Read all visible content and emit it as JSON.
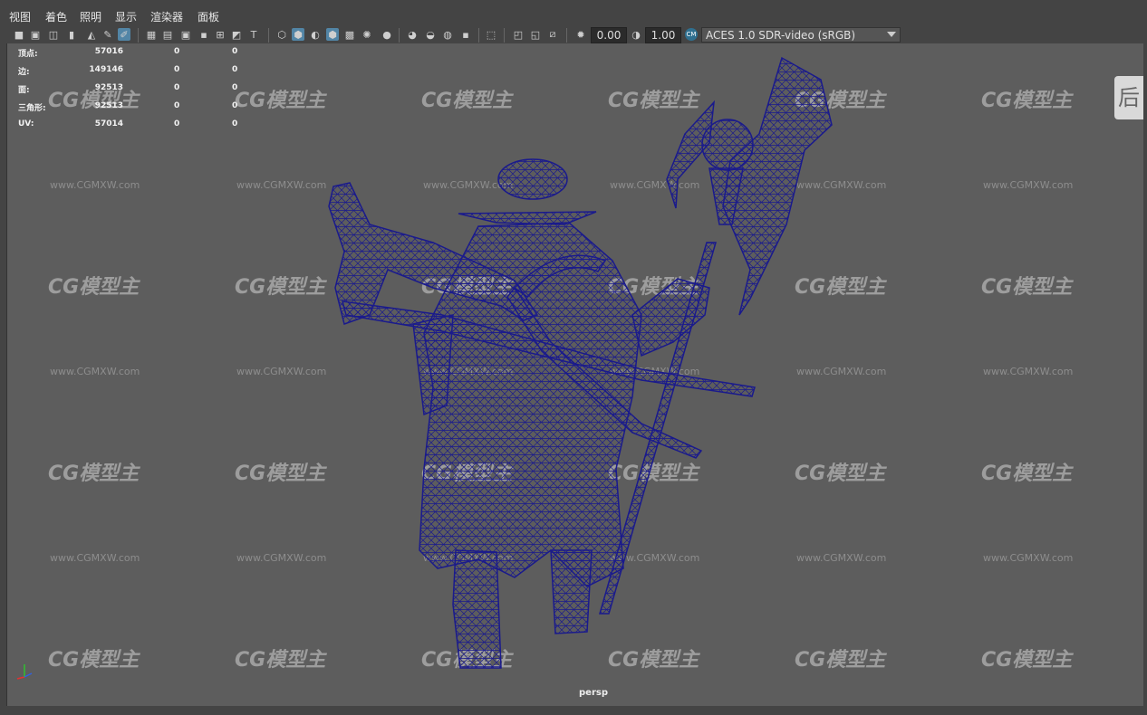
{
  "menu": {
    "items": [
      "视图",
      "着色",
      "照明",
      "显示",
      "渲染器",
      "面板"
    ]
  },
  "toolbar": {
    "value_a": "0.00",
    "value_b": "1.00",
    "color_space": "ACES 1.0 SDR-video (sRGB)"
  },
  "hud": {
    "rows": [
      {
        "label": "顶点:",
        "v1": "57016",
        "v2": "0",
        "v3": "0"
      },
      {
        "label": "边:",
        "v1": "149146",
        "v2": "0",
        "v3": "0"
      },
      {
        "label": "面:",
        "v1": "92513",
        "v2": "0",
        "v3": "0"
      },
      {
        "label": "三角形:",
        "v1": "92513",
        "v2": "0",
        "v3": "0"
      },
      {
        "label": "UV:",
        "v1": "57014",
        "v2": "0",
        "v3": "0"
      }
    ]
  },
  "viewport": {
    "camera_label": "persp",
    "side_tab_label": "后",
    "watermark_logo": "CG模型主",
    "watermark_url": "www.CGMXW.com"
  },
  "colors": {
    "viewport_bg": "#5d5d5d",
    "wireframe": "#1a1a8c",
    "accent": "#5285a6"
  }
}
